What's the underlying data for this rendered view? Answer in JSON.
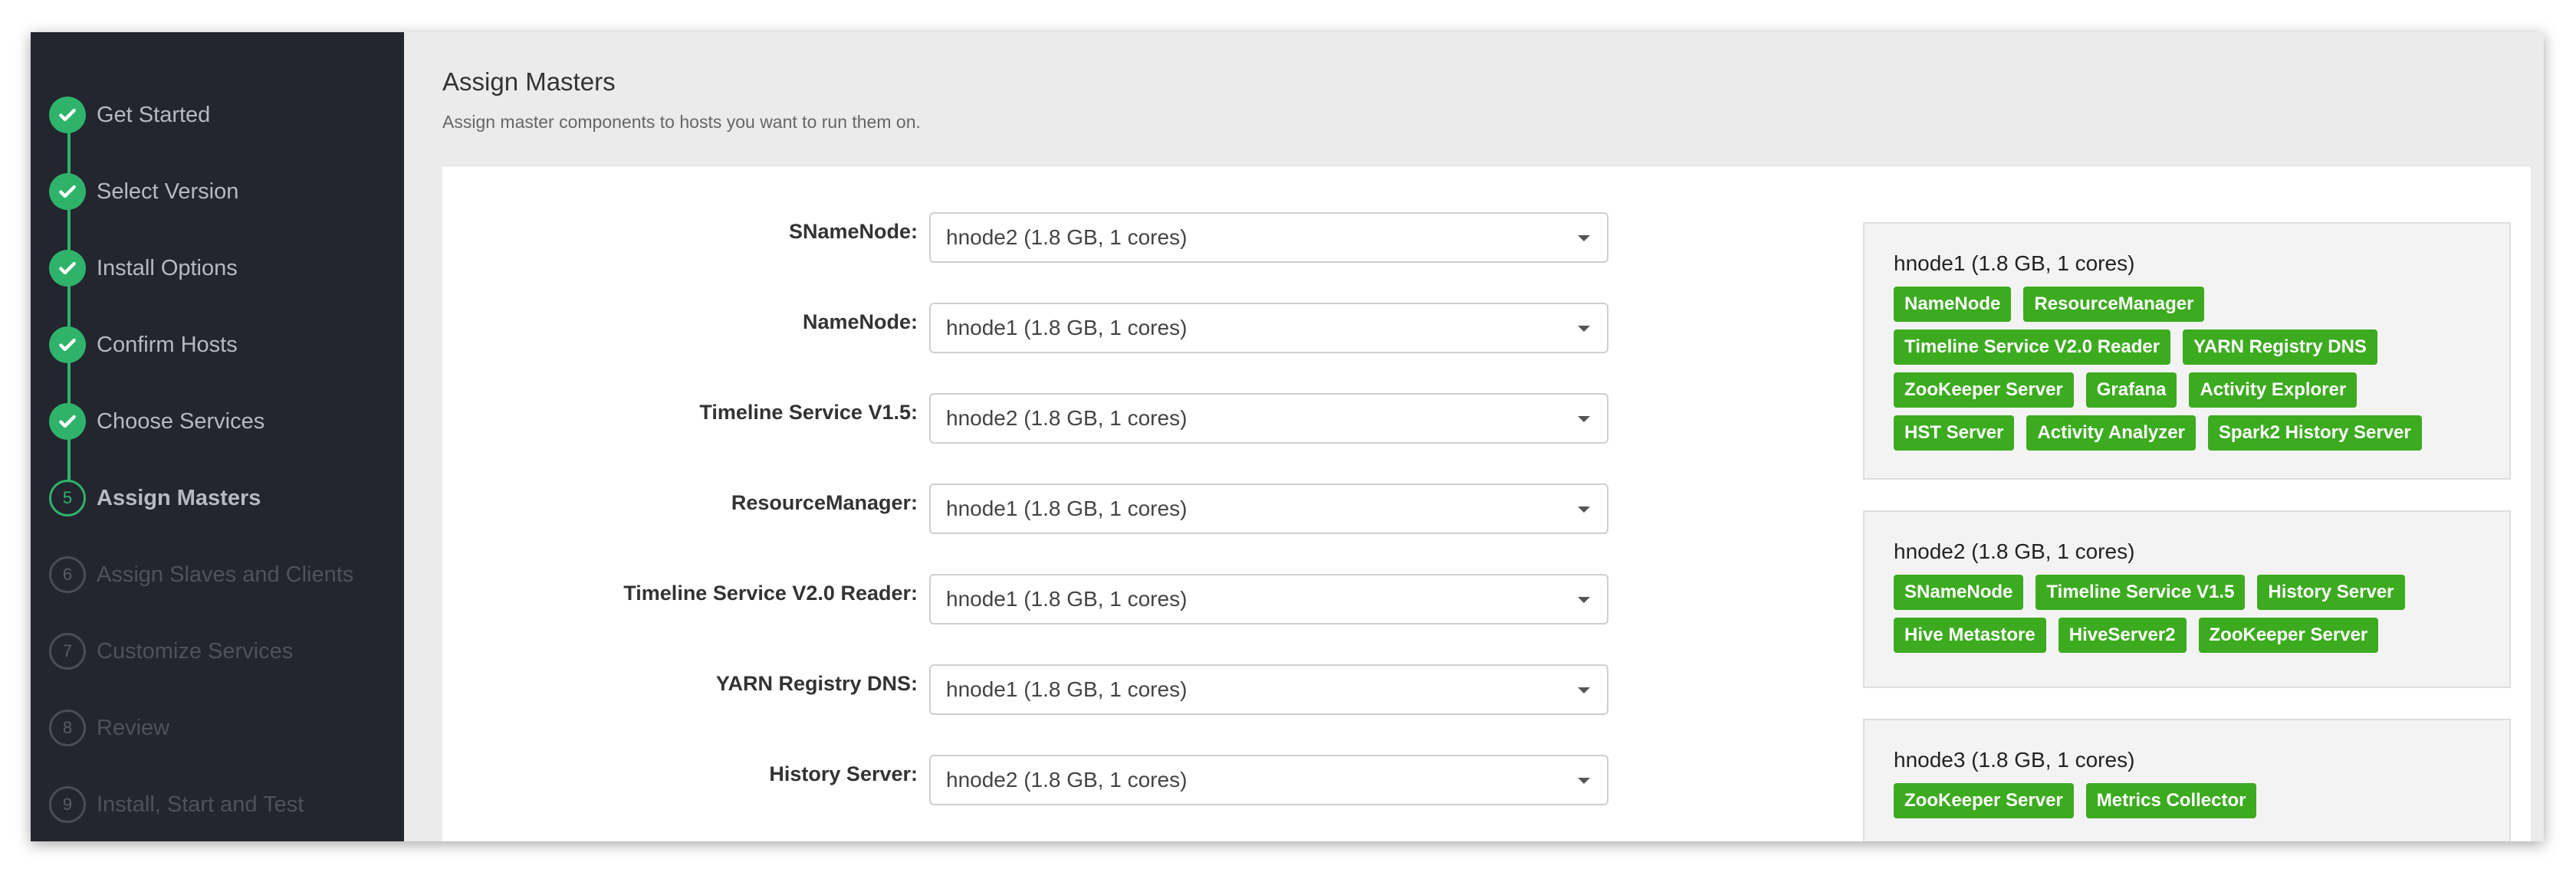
{
  "sidebar": {
    "steps": [
      {
        "num": "1",
        "label": "Get Started",
        "state": "done"
      },
      {
        "num": "2",
        "label": "Select Version",
        "state": "done"
      },
      {
        "num": "3",
        "label": "Install Options",
        "state": "done"
      },
      {
        "num": "4",
        "label": "Confirm Hosts",
        "state": "done"
      },
      {
        "num": "5",
        "label": "Choose Services",
        "state": "done"
      },
      {
        "num": "5",
        "label": "Assign Masters",
        "state": "current"
      },
      {
        "num": "6",
        "label": "Assign Slaves and Clients",
        "state": "future"
      },
      {
        "num": "7",
        "label": "Customize Services",
        "state": "future"
      },
      {
        "num": "8",
        "label": "Review",
        "state": "future"
      },
      {
        "num": "9",
        "label": "Install, Start and Test",
        "state": "future"
      }
    ]
  },
  "header": {
    "title": "Assign Masters",
    "subtitle": "Assign master components to hosts you want to run them on."
  },
  "assignments": [
    {
      "label": "SNameNode:",
      "value": "hnode2 (1.8 GB, 1 cores)"
    },
    {
      "label": "NameNode:",
      "value": "hnode1 (1.8 GB, 1 cores)"
    },
    {
      "label": "Timeline Service V1.5:",
      "value": "hnode2 (1.8 GB, 1 cores)"
    },
    {
      "label": "ResourceManager:",
      "value": "hnode1 (1.8 GB, 1 cores)"
    },
    {
      "label": "Timeline Service V2.0 Reader:",
      "value": "hnode1 (1.8 GB, 1 cores)"
    },
    {
      "label": "YARN Registry DNS:",
      "value": "hnode1 (1.8 GB, 1 cores)"
    },
    {
      "label": "History Server:",
      "value": "hnode2 (1.8 GB, 1 cores)"
    }
  ],
  "hosts": [
    {
      "title": "hnode1 (1.8 GB, 1 cores)",
      "components": [
        "NameNode",
        "ResourceManager",
        "Timeline Service V2.0 Reader",
        "YARN Registry DNS",
        "ZooKeeper Server",
        "Grafana",
        "Activity Explorer",
        "HST Server",
        "Activity Analyzer",
        "Spark2 History Server"
      ]
    },
    {
      "title": "hnode2 (1.8 GB, 1 cores)",
      "components": [
        "SNameNode",
        "Timeline Service V1.5",
        "History Server",
        "Hive Metastore",
        "HiveServer2",
        "ZooKeeper Server"
      ]
    },
    {
      "title": "hnode3 (1.8 GB, 1 cores)",
      "components": [
        "ZooKeeper Server",
        "Metrics Collector"
      ]
    }
  ],
  "colors": {
    "sidebar_bg": "#23252f",
    "step_done": "#2fb36b",
    "tag_green": "#3cab1f"
  }
}
